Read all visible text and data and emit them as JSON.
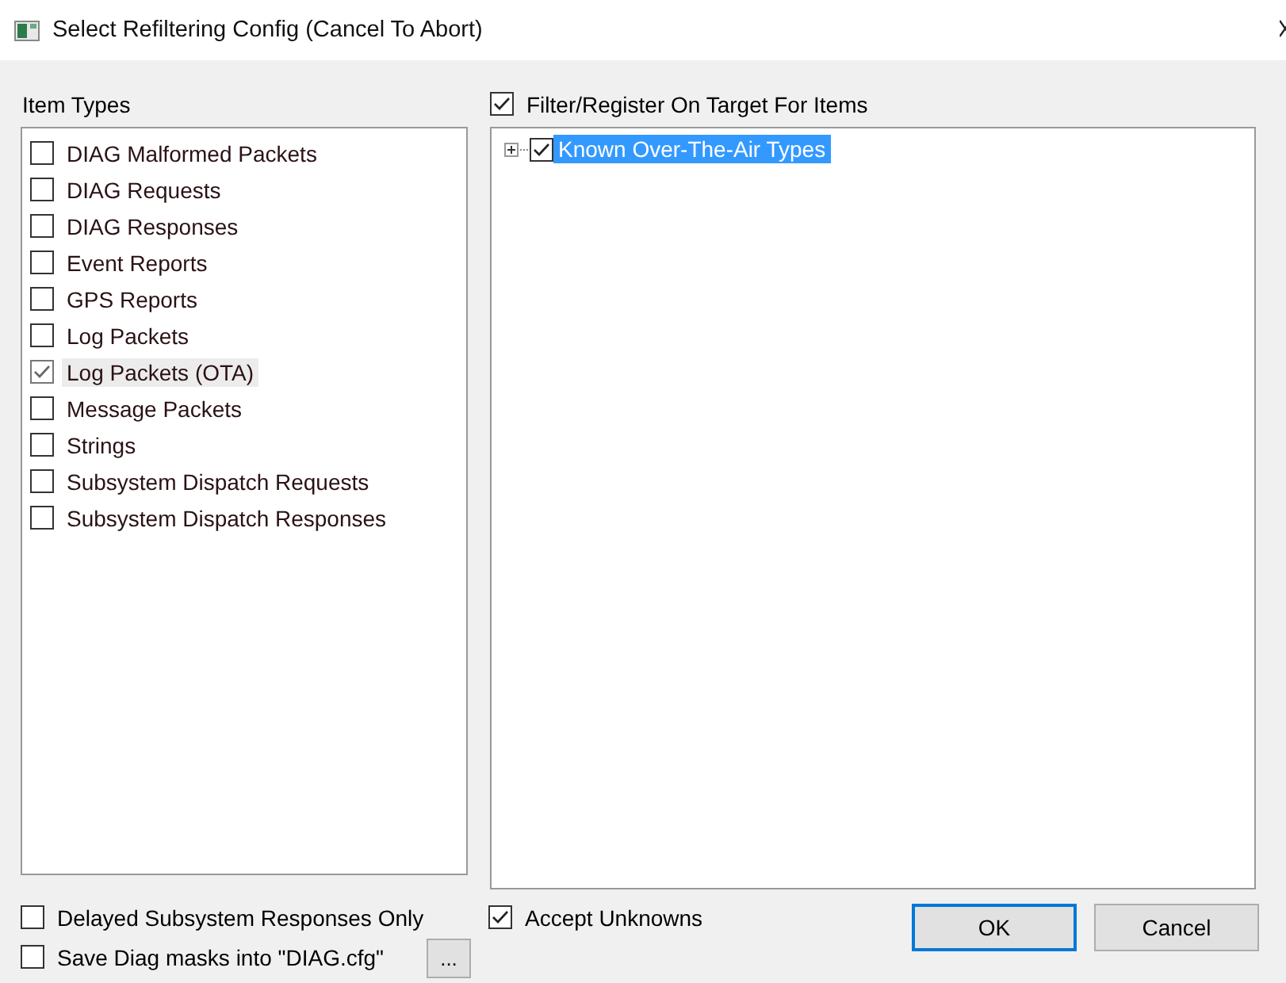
{
  "window": {
    "title": "Select Refiltering Config (Cancel To Abort)"
  },
  "item_types": {
    "label": "Item Types",
    "items": [
      {
        "label": "DIAG Malformed Packets",
        "checked": false,
        "selected": false
      },
      {
        "label": "DIAG Requests",
        "checked": false,
        "selected": false
      },
      {
        "label": "DIAG Responses",
        "checked": false,
        "selected": false
      },
      {
        "label": "Event Reports",
        "checked": false,
        "selected": false
      },
      {
        "label": "GPS Reports",
        "checked": false,
        "selected": false
      },
      {
        "label": "Log Packets",
        "checked": false,
        "selected": false
      },
      {
        "label": "Log Packets (OTA)",
        "checked": true,
        "selected": true
      },
      {
        "label": "Message Packets",
        "checked": false,
        "selected": false
      },
      {
        "label": "Strings",
        "checked": false,
        "selected": false
      },
      {
        "label": "Subsystem Dispatch Requests",
        "checked": false,
        "selected": false
      },
      {
        "label": "Subsystem Dispatch Responses",
        "checked": false,
        "selected": false
      }
    ]
  },
  "filter_register": {
    "label": "Filter/Register On Target For Items",
    "checked": true
  },
  "tree": [
    {
      "label": "Known Over-The-Air Types",
      "checked": true,
      "selected": true,
      "expanded": false
    }
  ],
  "delayed_only": {
    "label": "Delayed Subsystem Responses Only",
    "checked": false
  },
  "save_masks": {
    "label": "Save Diag masks into \"DIAG.cfg\"",
    "checked": false
  },
  "browse_button": "...",
  "accept_unknowns": {
    "label": "Accept Unknowns",
    "checked": true
  },
  "buttons": [
    {
      "label": "OK",
      "default": true
    },
    {
      "label": "Cancel",
      "default": false
    }
  ]
}
